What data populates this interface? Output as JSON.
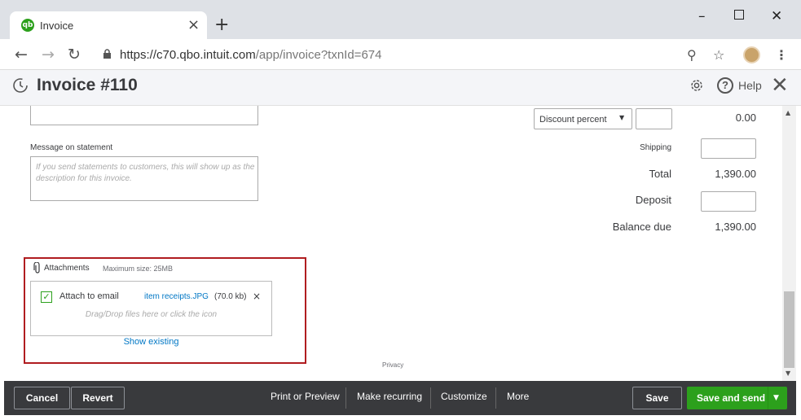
{
  "browser": {
    "tab_title": "Invoice",
    "favicon_text": "qb",
    "url_host": "https://c70.qbo.intuit.com",
    "url_path": "/app/invoice?txnId=674"
  },
  "header": {
    "title": "Invoice #110",
    "help_label": "Help"
  },
  "form": {
    "message_label": "Message on statement",
    "message_placeholder": "If you send statements to customers, this will show up as the description for this invoice.",
    "discount_select": "Discount percent",
    "discount_value": "0.00",
    "shipping_label": "Shipping",
    "total_label": "Total",
    "total_value": "1,390.00",
    "deposit_label": "Deposit",
    "balance_label": "Balance due",
    "balance_value": "1,390.00"
  },
  "attachments": {
    "label": "Attachments",
    "max_size": "Maximum size: 25MB",
    "attach_to_email": "Attach to email",
    "file_name": "item receipts.JPG",
    "file_size": "(70.0 kb)",
    "drop_hint": "Drag/Drop files here or click the icon",
    "show_existing": "Show existing"
  },
  "privacy": "Privacy",
  "footer": {
    "cancel": "Cancel",
    "revert": "Revert",
    "print_preview": "Print or Preview",
    "make_recurring": "Make recurring",
    "customize": "Customize",
    "more": "More",
    "save": "Save",
    "save_and_send": "Save and send"
  },
  "colors": {
    "brand_green": "#2ca01c",
    "highlight_red": "#b01d20",
    "footer_bg": "#393a3d",
    "link_blue": "#0077c5"
  }
}
